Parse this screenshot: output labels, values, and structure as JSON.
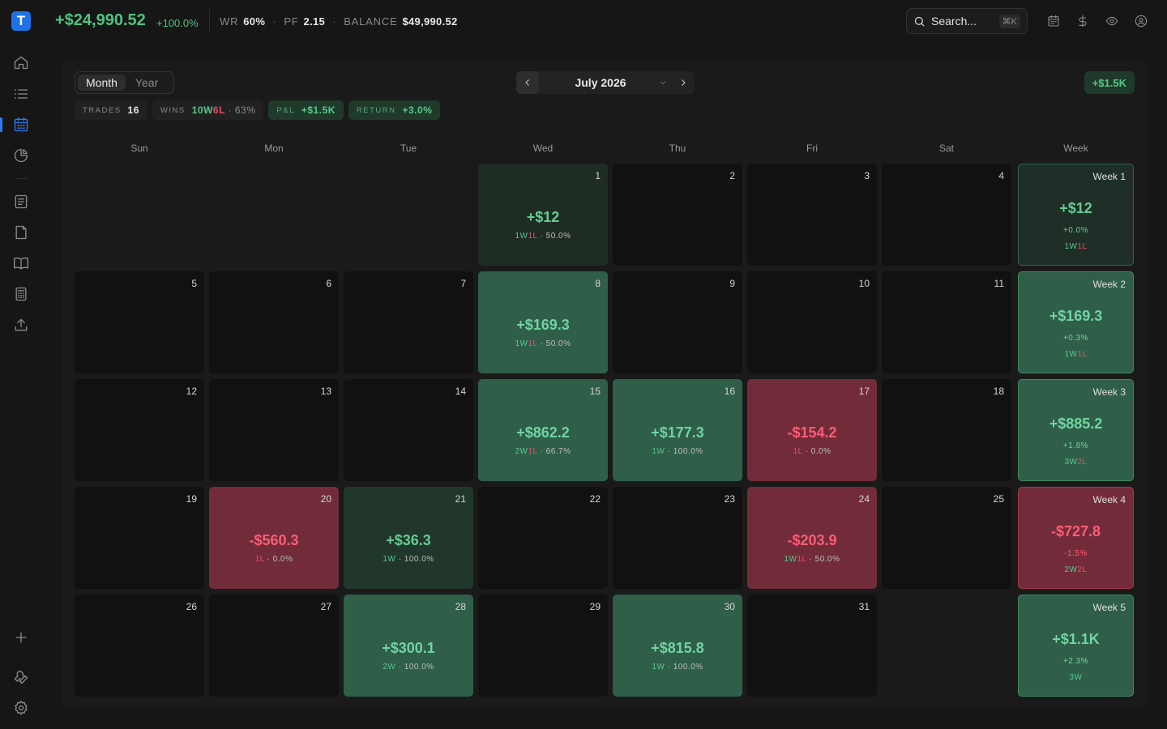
{
  "app": {
    "logo_letter": "T"
  },
  "topbar": {
    "pnl_total": "+$24,990.52",
    "pnl_pct": "+100.0%",
    "wr_label": "WR",
    "wr_value": "60%",
    "pf_label": "PF",
    "pf_value": "2.15",
    "balance_label": "BALANCE",
    "balance_value": "$49,990.52",
    "search_placeholder": "Search...",
    "search_shortcut": "⌘K"
  },
  "panel": {
    "view_options": [
      "Month",
      "Year"
    ],
    "selected_view": "Month",
    "month_label": "July 2026",
    "total_badge": "+$1.5K",
    "summary": {
      "trades_label": "TRADES",
      "trades_value": "16",
      "wins_label": "WINS",
      "wins_w": "10W",
      "wins_l": "6L",
      "wins_pct": "· 63%",
      "pnl_label": "P&L",
      "pnl_value": "+$1.5K",
      "return_label": "RETURN",
      "return_value": "+3.0%"
    },
    "day_headers": [
      "Sun",
      "Mon",
      "Tue",
      "Wed",
      "Thu",
      "Fri",
      "Sat",
      "Week"
    ]
  },
  "days": [
    {
      "d": "1",
      "amt": "+$12",
      "w": "1W",
      "l": "1L",
      "pct": "· 50.0%",
      "tone": "pos-light"
    },
    {
      "d": "2"
    },
    {
      "d": "3"
    },
    {
      "d": "4"
    },
    {
      "d": "5"
    },
    {
      "d": "6"
    },
    {
      "d": "7"
    },
    {
      "d": "8",
      "amt": "+$169.3",
      "w": "1W",
      "l": "1L",
      "pct": "· 50.0%",
      "tone": "pos"
    },
    {
      "d": "9"
    },
    {
      "d": "10"
    },
    {
      "d": "11"
    },
    {
      "d": "12"
    },
    {
      "d": "13"
    },
    {
      "d": "14"
    },
    {
      "d": "15",
      "amt": "+$862.2",
      "w": "2W",
      "l": "1L",
      "pct": "· 66.7%",
      "tone": "pos"
    },
    {
      "d": "16",
      "amt": "+$177.3",
      "w": "1W",
      "l": "",
      "pct": "· 100.0%",
      "tone": "pos"
    },
    {
      "d": "17",
      "amt": "-$154.2",
      "w": "",
      "l": "1L",
      "pct": "· 0.0%",
      "tone": "neg"
    },
    {
      "d": "18"
    },
    {
      "d": "19"
    },
    {
      "d": "20",
      "amt": "-$560.3",
      "w": "",
      "l": "1L",
      "pct": "· 0.0%",
      "tone": "neg"
    },
    {
      "d": "21",
      "amt": "+$36.3",
      "w": "1W",
      "l": "",
      "pct": "· 100.0%",
      "tone": "pos-dark"
    },
    {
      "d": "22"
    },
    {
      "d": "23"
    },
    {
      "d": "24",
      "amt": "-$203.9",
      "w": "1W",
      "l": "1L",
      "pct": "· 50.0%",
      "tone": "neg"
    },
    {
      "d": "25"
    },
    {
      "d": "26"
    },
    {
      "d": "27"
    },
    {
      "d": "28",
      "amt": "+$300.1",
      "w": "2W",
      "l": "",
      "pct": "· 100.0%",
      "tone": "pos"
    },
    {
      "d": "29"
    },
    {
      "d": "30",
      "amt": "+$815.8",
      "w": "1W",
      "l": "",
      "pct": "· 100.0%",
      "tone": "pos"
    },
    {
      "d": "31"
    }
  ],
  "weeks": [
    {
      "label": "Week 1",
      "amt": "+$12",
      "pct": "+0.0%",
      "w": "1W",
      "l": "1L",
      "tone": "pos-light"
    },
    {
      "label": "Week 2",
      "amt": "+$169.3",
      "pct": "+0.3%",
      "w": "1W",
      "l": "1L",
      "tone": "pos"
    },
    {
      "label": "Week 3",
      "amt": "+$885.2",
      "pct": "+1.8%",
      "w": "3W",
      "l": "2L",
      "tone": "pos"
    },
    {
      "label": "Week 4",
      "amt": "-$727.8",
      "pct": "-1.5%",
      "w": "2W",
      "l": "2L",
      "tone": "neg"
    },
    {
      "label": "Week 5",
      "amt": "+$1.1K",
      "pct": "+2.3%",
      "w": "3W",
      "l": "",
      "tone": "pos"
    }
  ],
  "icons": {
    "sidebar": [
      "home-icon",
      "list-icon",
      "calendar-icon",
      "pie-chart-icon",
      "journal-icon",
      "notes-icon",
      "book-icon",
      "calculator-icon",
      "upload-icon",
      "plus-icon",
      "wrench-icon",
      "gear-icon"
    ],
    "topbar": [
      "calendar-icon",
      "dollar-icon",
      "eye-icon",
      "user-icon"
    ]
  },
  "colors": {
    "positive": "#57c98a",
    "negative": "#e5506a",
    "accent": "#2f7cf0"
  }
}
